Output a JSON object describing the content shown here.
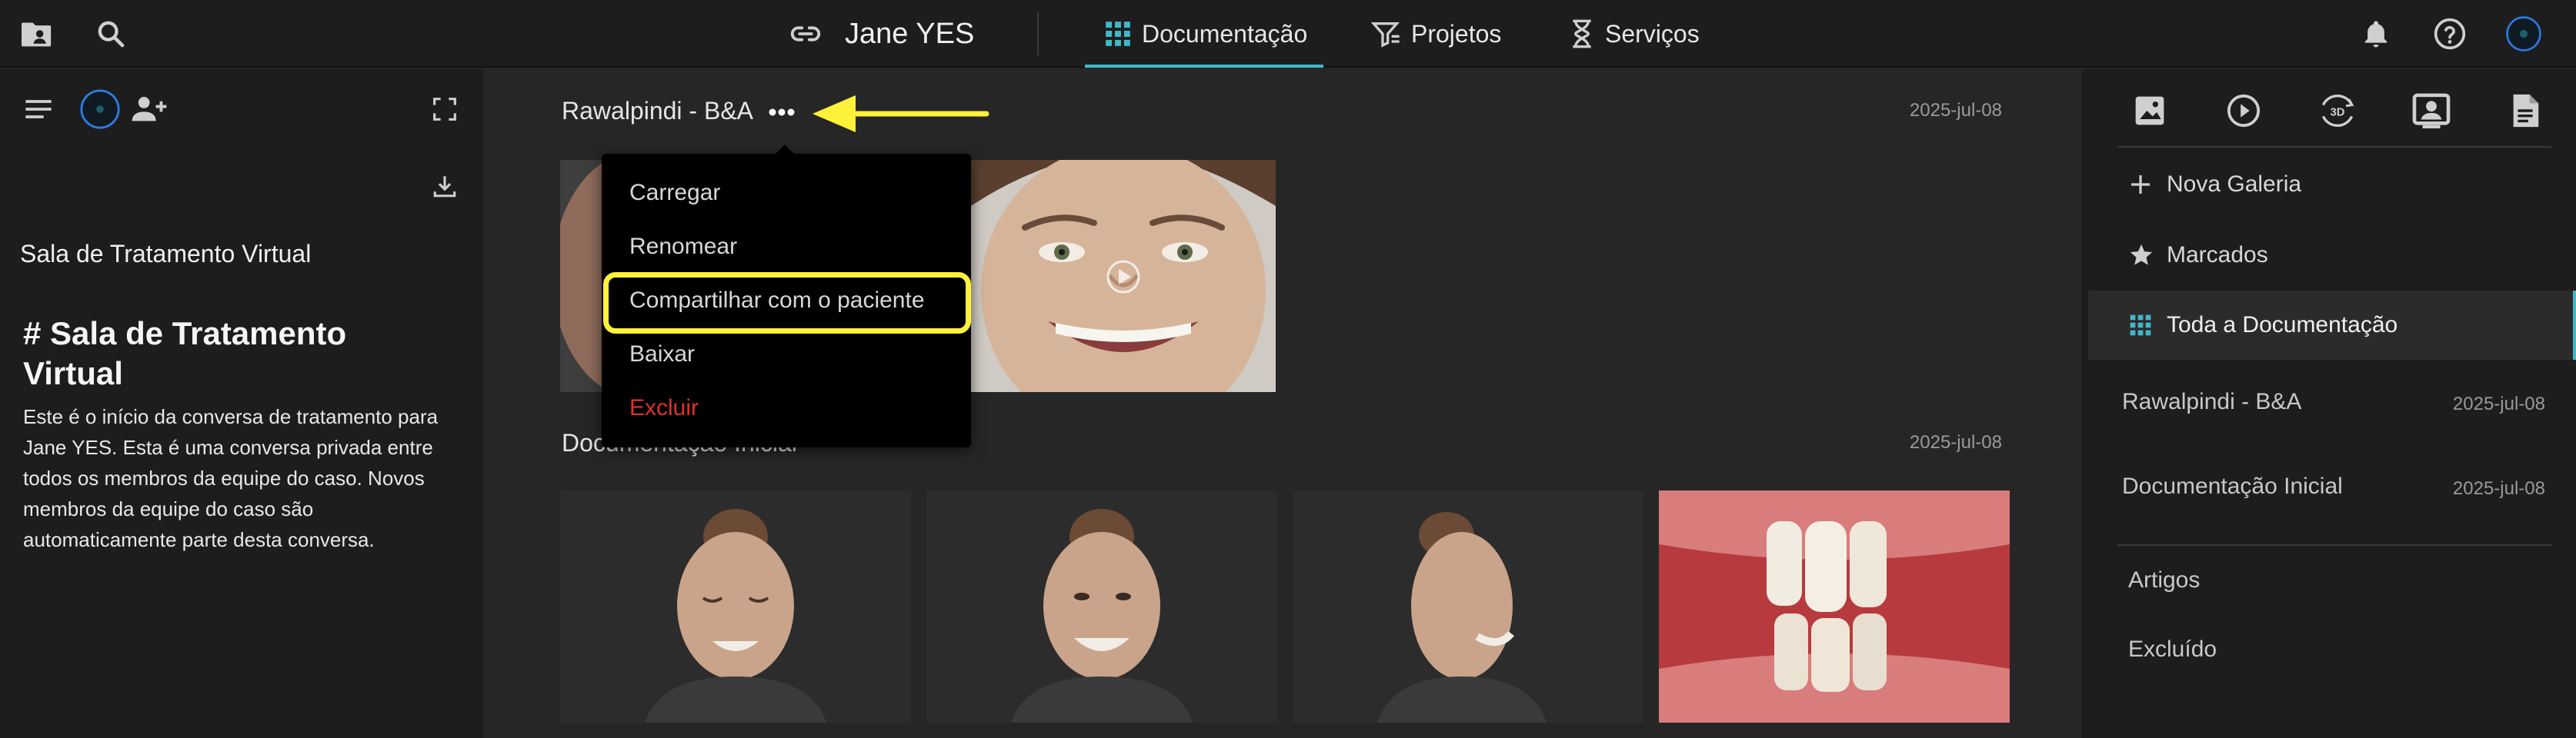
{
  "topbar": {
    "patient_name": "Jane YES",
    "tabs": [
      {
        "label": "Documentação",
        "icon": "grid-icon",
        "active": true
      },
      {
        "label": "Projetos",
        "icon": "filter-list-icon"
      },
      {
        "label": "Serviços",
        "icon": "hourglass-icon"
      }
    ]
  },
  "left_panel": {
    "room_title": "Sala de Tratamento Virtual",
    "heading": "# Sala de Tratamento Virtual",
    "body": "Este é o início da conversa de tratamento para Jane YES. Esta é uma conversa privada entre todos os membros da equipe do caso. Novos membros da equipe do caso são automaticamente parte desta conversa."
  },
  "main": {
    "sections": [
      {
        "title": "Rawalpindi - B&A",
        "date": "2025-jul-08"
      },
      {
        "title": "Documentação Inicial",
        "date": "2025-jul-08"
      }
    ]
  },
  "context_menu": {
    "items": [
      "Carregar",
      "Renomear",
      "Compartilhar com o paciente",
      "Baixar",
      "Excluir"
    ],
    "highlighted_item": "Compartilhar com o paciente"
  },
  "right_panel": {
    "menu": [
      {
        "label": "Nova Galeria",
        "icon": "plus-icon"
      },
      {
        "label": "Marcados",
        "icon": "star-icon"
      },
      {
        "label": "Toda a Documentação",
        "icon": "grid-icon",
        "active": true
      }
    ],
    "galleries": [
      {
        "name": "Rawalpindi - B&A",
        "date": "2025-jul-08"
      },
      {
        "name": "Documentação Inicial",
        "date": "2025-jul-08"
      }
    ],
    "links": [
      "Artigos",
      "Excluído"
    ]
  },
  "colors": {
    "accent": "#3fb9c8",
    "highlight": "#fff23a",
    "danger": "#e0302a",
    "panel_bg": "#1d1d1d",
    "main_bg": "#262626"
  }
}
